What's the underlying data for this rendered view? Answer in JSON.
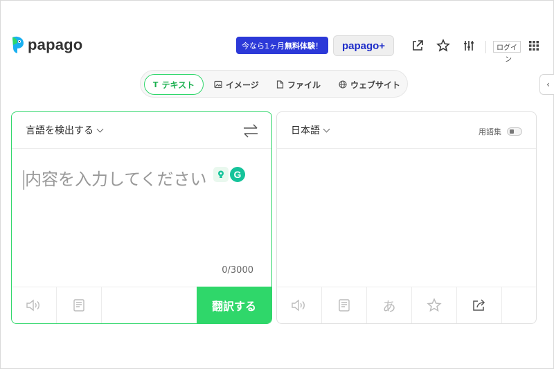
{
  "brand": {
    "name": "papago",
    "color": "#2fd76a",
    "accent_blue": "#2c39d8"
  },
  "header": {
    "promo_prefix": "今なら1ヶ月",
    "promo_bold": "無料体験",
    "promo_suffix": "！",
    "plus_label": "papago+",
    "icons": [
      "share-external-icon",
      "star-icon",
      "settings-sliders-icon",
      "apps-grid-icon"
    ],
    "login_label": "ログイ",
    "login_tail": "ン"
  },
  "tabs": [
    {
      "label": "テキスト",
      "icon": "text-icon",
      "active": true
    },
    {
      "label": "イメージ",
      "icon": "image-icon",
      "active": false
    },
    {
      "label": "ファイル",
      "icon": "file-icon",
      "active": false
    },
    {
      "label": "ウェブサイト",
      "icon": "globe-icon",
      "active": false
    }
  ],
  "side_toggle": "‹",
  "source": {
    "language": "言語を検出する",
    "placeholder": "内容を入力してください",
    "char_count": "0/3000",
    "translate_label": "翻訳する"
  },
  "target": {
    "language": "日本語",
    "glossary_label": "用語集",
    "hiragana_label": "あ"
  }
}
